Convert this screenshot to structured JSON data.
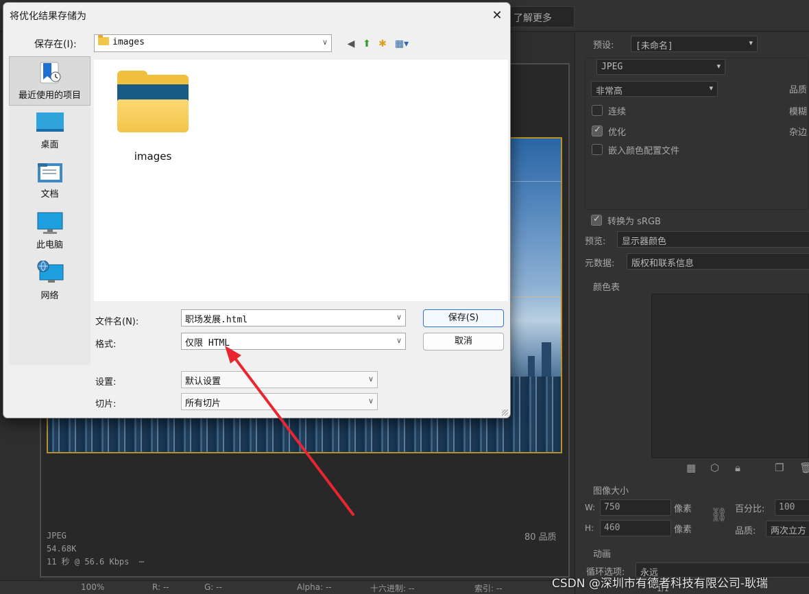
{
  "background": {
    "learn_more": "了解更多",
    "preview_info": {
      "format": "JPEG",
      "size": "54.68K",
      "time": "11 秒 @ 56.6 Kbps",
      "menu_glyph": "⋯",
      "quality": "80 品质"
    },
    "bottom_bar": {
      "zoom": "100%",
      "r": "R: --",
      "g": "G: --",
      "alpha": "Alpha: --",
      "hex": "十六进制: --",
      "index": "索引: --"
    },
    "right_panel": {
      "preset_label": "预设:",
      "preset_value": "[未命名]",
      "format_value": "JPEG",
      "quality_preset": "非常高",
      "quality_label": "品质",
      "progressive_label": "连续",
      "blur_label": "模糊",
      "optimized_label": "优化",
      "matte_label": "杂边",
      "embed_profile_label": "嵌入颜色配置文件",
      "convert_srgb_label": "转换为 sRGB",
      "preview_label": "预览:",
      "preview_value": "显示器颜色",
      "metadata_label": "元数据:",
      "metadata_value": "版权和联系信息",
      "color_table_label": "颜色表",
      "image_size_label": "图像大小",
      "w_label": "W:",
      "w_value": "750",
      "h_label": "H:",
      "h_value": "460",
      "px_label": "像素",
      "percent_label": "百分比:",
      "percent_value": "100",
      "quality2_label": "品质:",
      "quality2_value": "两次立方",
      "animation_label": "动画",
      "loop_label": "循环选项:",
      "loop_value": "永远",
      "frame_counter": "1/1"
    }
  },
  "dialog": {
    "title": "将优化结果存储为",
    "close_glyph": "✕",
    "save_in_label": "保存在(I):",
    "save_in_value": "images",
    "toolbar_glyphs": {
      "back": "◀",
      "up": "⬆",
      "new_folder": "✱",
      "views": "▦▾"
    },
    "places": [
      "最近使用的项目",
      "桌面",
      "文档",
      "此电脑",
      "网络"
    ],
    "folder_item": "images",
    "filename_label": "文件名(N):",
    "filename_value": "职场发展.html",
    "format_label": "格式:",
    "format_value": "仅限 HTML",
    "settings_label": "设置:",
    "settings_value": "默认设置",
    "slices_label": "切片:",
    "slices_value": "所有切片",
    "save_button": "保存(S)",
    "cancel_button": "取消"
  },
  "watermark": "CSDN @深圳市有德者科技有限公司-耿瑞",
  "colors": {
    "accent_arrow": "#e8262f",
    "dialog_bg": "#f0f0f0",
    "folder_yellow": "#f0c03c",
    "primary_border": "#2d6fd1"
  }
}
